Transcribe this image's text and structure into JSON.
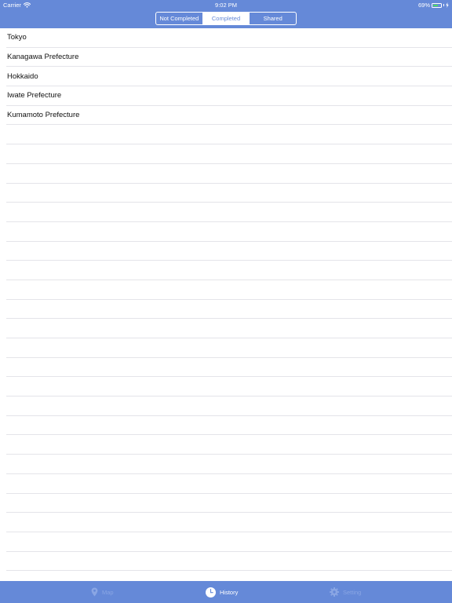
{
  "status_bar": {
    "carrier": "Carrier",
    "time": "9:02 PM",
    "battery_percent": "69%",
    "battery_level": 0.69
  },
  "segmented_control": {
    "segments": [
      "Not Completed",
      "Completed",
      "Shared"
    ],
    "selected_index": 1
  },
  "list": {
    "items": [
      "Tokyo",
      "Kanagawa Prefecture",
      "Hokkaido",
      "Iwate Prefecture",
      "Kumamoto Prefecture"
    ],
    "empty_rows": 23
  },
  "tab_bar": {
    "tabs": [
      {
        "label": "Map",
        "icon": "pin-icon",
        "active": false
      },
      {
        "label": "History",
        "icon": "clock-icon",
        "active": true
      },
      {
        "label": "Setting",
        "icon": "gear-icon",
        "active": false
      }
    ]
  },
  "colors": {
    "accent": "#6589d8",
    "separator": "#e4e4e9",
    "inactive_tab": "#8aa6e4",
    "battery": "#4cd964"
  }
}
